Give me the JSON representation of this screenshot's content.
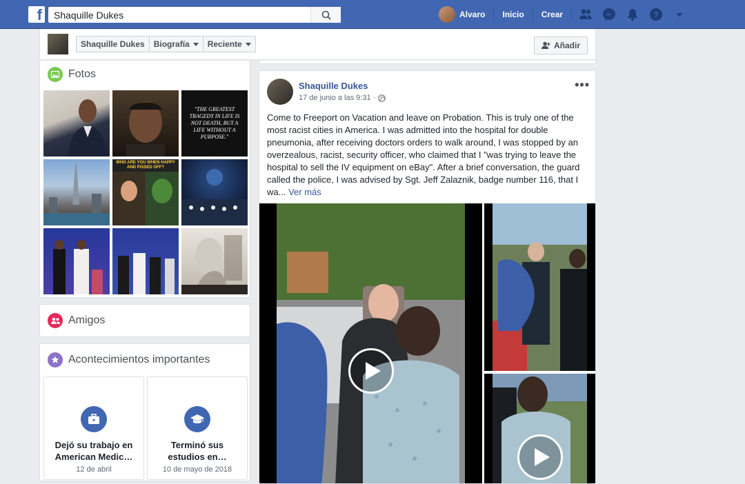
{
  "topbar": {
    "search_value": "Shaquille Dukes",
    "user_name": "Alvaro",
    "home_label": "Inicio",
    "create_label": "Crear",
    "icons": [
      "friends-icon",
      "messenger-icon",
      "bell-icon",
      "help-icon",
      "dropdown-icon"
    ]
  },
  "profile_nav": {
    "name_tab": "Shaquille Dukes",
    "bio_tab": "Biografía",
    "recent_tab": "Reciente",
    "add_button": "Añadir"
  },
  "photos": {
    "title": "Fotos",
    "quote_text": "\"THE GREATEST TRAGEDY IN LIFE IS NOT DEATH, BUT A LIFE WITHOUT A PURPOSE.\"",
    "meme_text": "WHO ARE YOU WHEN HAPPY AND PISSED OFF?"
  },
  "friends": {
    "title": "Amigos"
  },
  "life_events": {
    "title": "Acontecimientos importantes",
    "events": [
      {
        "title": "Dejó su trabajo en American Medic…",
        "date": "12 de abril"
      },
      {
        "title": "Terminó sus estudios en…",
        "date": "10 de mayo de 2018"
      }
    ]
  },
  "post": {
    "author": "Shaquille Dukes",
    "time": "17 de junio a las 9:31 ·",
    "text": "Come to Freeport on Vacation and leave on Probation. This is truly one of the most racist cities in America. I was admitted into the hospital for double pneumonia, after receiving doctors orders to walk around, I was stopped by an overzealous, racist, security officer, who claimed that I \"was trying to leave the hospital to sell the IV equipment on eBay\". After a brief conversation, the guard called the police, I was advised by Sgt. Jeff Zalaznik, badge number 116, that I wa...",
    "see_more": "Ver más"
  },
  "colors": {
    "brand": "#4267b2",
    "link": "#365899",
    "background": "#e9ebee"
  }
}
